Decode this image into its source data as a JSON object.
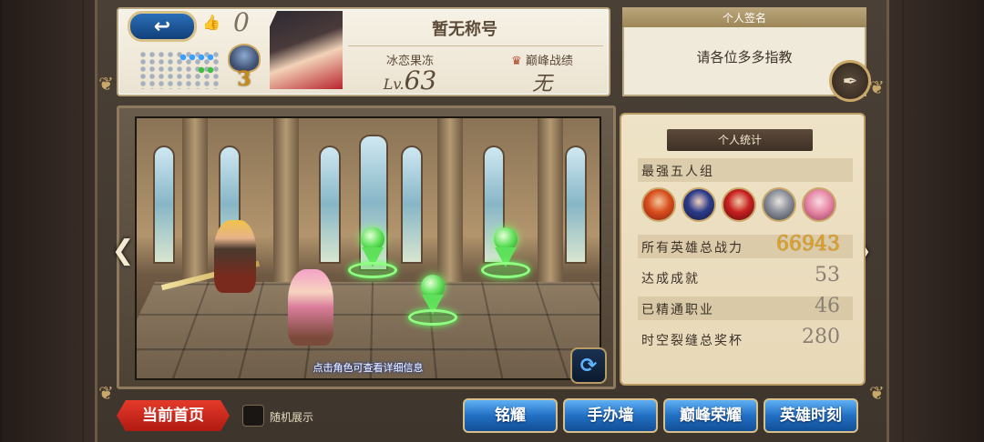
{
  "header": {
    "back_icon": "↩",
    "like_icon": "👍",
    "like_count": "0",
    "title": "暂无称号",
    "rank_number": "3",
    "player_name": "冰恋果冻",
    "level_prefix": "Lv.",
    "level": "63",
    "peak_label": "巅峰战绩",
    "peak_value": "无"
  },
  "signature": {
    "heading": "个人签名",
    "text": "请各位多多指教",
    "edit_icon": "✒"
  },
  "scene": {
    "hint": "点击角色可查看详细信息",
    "refresh_icon": "⟳"
  },
  "stats": {
    "heading": "个人统计",
    "team_label": "最强五人组",
    "rows": [
      {
        "label": "所有英雄总战力",
        "value": "66943"
      },
      {
        "label": "达成成就",
        "value": "53"
      },
      {
        "label": "已精通职业",
        "value": "46"
      },
      {
        "label": "时空裂缝总奖杯",
        "value": "280"
      }
    ]
  },
  "bottom": {
    "home_label": "当前首页",
    "random_label": "随机展示",
    "buttons": [
      "铭耀",
      "手办墙",
      "巅峰荣耀",
      "英雄时刻"
    ]
  },
  "colors": {
    "accent_gold": "#e0a220",
    "button_blue": "#2270c4",
    "home_red": "#d12a1c",
    "marker_green": "#5fe05a"
  }
}
